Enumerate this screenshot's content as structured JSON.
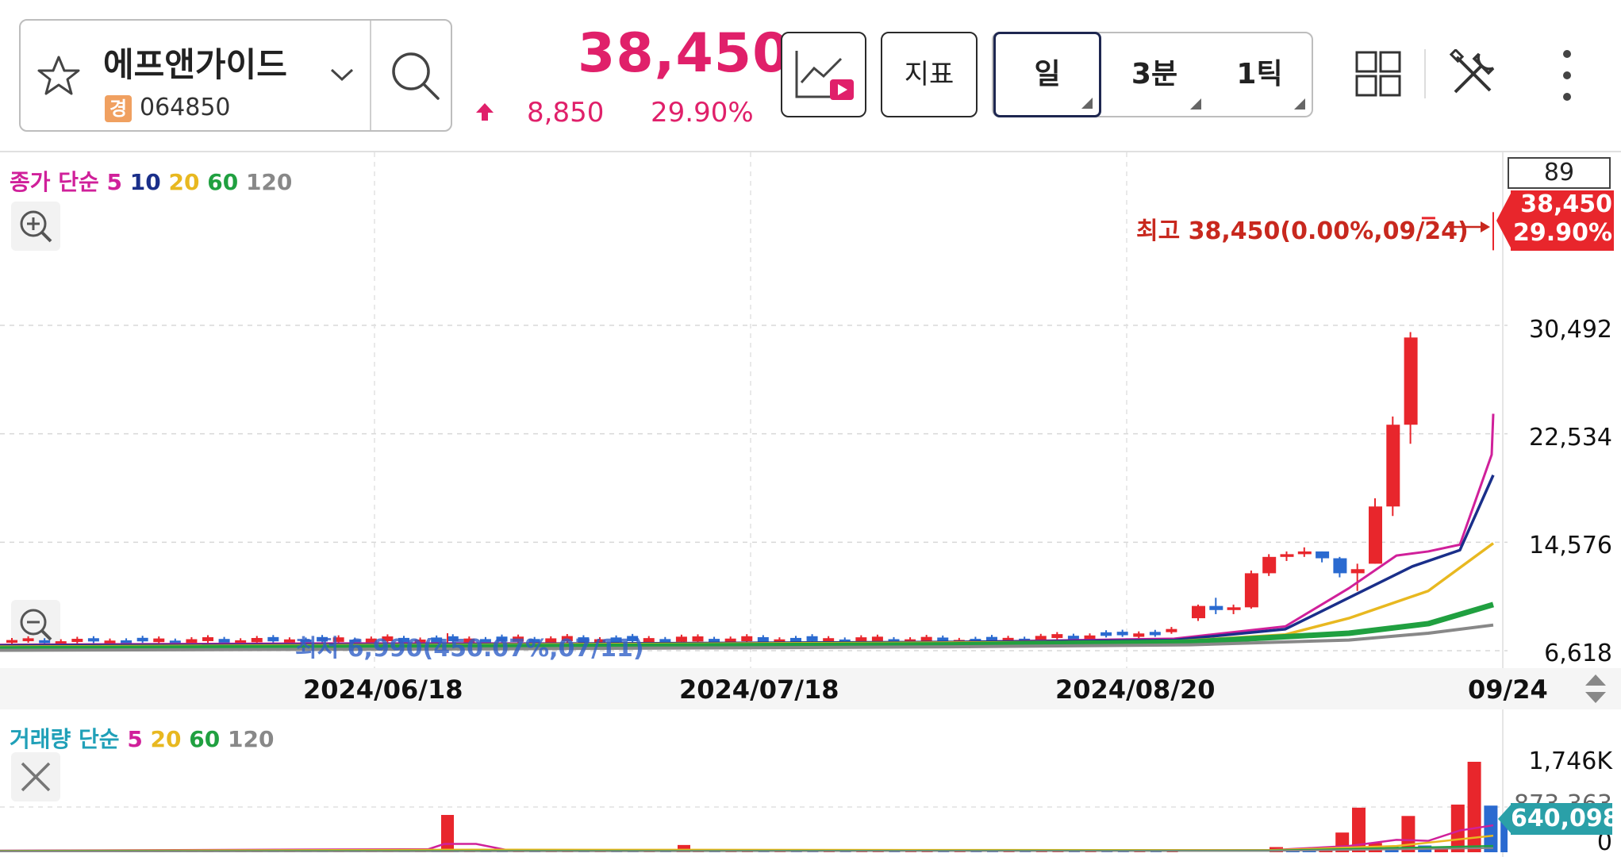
{
  "stock": {
    "name": "에프앤가이드",
    "market_badge": "경",
    "code": "064850",
    "price": "38,450",
    "change": "8,850",
    "change_rate": "29.90%",
    "up_color": "#e0206a"
  },
  "toolbar": {
    "indicator_label": "지표",
    "periods": [
      "일",
      "3분",
      "1틱"
    ],
    "active_period": "일"
  },
  "price_chart": {
    "legend_prefix": "종가 단순",
    "ma_legend": [
      {
        "label": "5",
        "color": "#d0209a"
      },
      {
        "label": "10",
        "color": "#1a2f8a"
      },
      {
        "label": "20",
        "color": "#e8b820"
      },
      {
        "label": "60",
        "color": "#20a040"
      },
      {
        "label": "120",
        "color": "#888888"
      }
    ],
    "count_box": "89",
    "current_tag": {
      "price": "38,450",
      "rate": "29.90%"
    },
    "high_annotation": "최고 38,450(0.00%,09/24)",
    "low_annotation": "최저 6,990(450.07%,07/11)",
    "y_ticks": [
      "30,492",
      "22,534",
      "14,576",
      "6,618"
    ],
    "x_dates": [
      "2024/06/18",
      "2024/07/18",
      "2024/08/20",
      "09/24"
    ]
  },
  "volume_chart": {
    "legend_prefix": "거래량 단순",
    "ma_legend": [
      {
        "label": "5",
        "color": "#d0209a"
      },
      {
        "label": "20",
        "color": "#e8b820"
      },
      {
        "label": "60",
        "color": "#20a040"
      },
      {
        "label": "120",
        "color": "#888888"
      }
    ],
    "y_ticks": [
      "1,746K",
      "873,363",
      "0"
    ],
    "current_tag": "640,098"
  },
  "chart_data": {
    "type": "candlestick",
    "ylim": [
      6618,
      38450
    ],
    "candles_recent": [
      {
        "o": 9000,
        "h": 10000,
        "l": 8800,
        "c": 9900
      },
      {
        "o": 9900,
        "h": 10500,
        "l": 9300,
        "c": 9600
      },
      {
        "o": 9600,
        "h": 10000,
        "l": 9300,
        "c": 9800
      },
      {
        "o": 9800,
        "h": 12500,
        "l": 9700,
        "c": 12300
      },
      {
        "o": 12300,
        "h": 13700,
        "l": 12100,
        "c": 13500
      },
      {
        "o": 13500,
        "h": 13900,
        "l": 13200,
        "c": 13700
      },
      {
        "o": 13700,
        "h": 14200,
        "l": 13500,
        "c": 13900
      },
      {
        "o": 13900,
        "h": 13900,
        "l": 13100,
        "c": 13400
      },
      {
        "o": 13400,
        "h": 13500,
        "l": 12000,
        "c": 12300
      },
      {
        "o": 12300,
        "h": 13000,
        "l": 11000,
        "c": 12600
      },
      {
        "o": 13000,
        "h": 17800,
        "l": 13000,
        "c": 17200
      },
      {
        "o": 17200,
        "h": 23800,
        "l": 16500,
        "c": 23200
      },
      {
        "o": 23200,
        "h": 30000,
        "l": 21800,
        "c": 29600
      },
      {
        "o": 38450,
        "h": 38450,
        "l": 38450,
        "c": 38450
      }
    ],
    "volume_recent": [
      {
        "v": 100000,
        "up": true
      },
      {
        "v": 50000,
        "up": false
      },
      {
        "v": 40000,
        "up": false
      },
      {
        "v": 60000,
        "up": true
      },
      {
        "v": 380000,
        "up": true
      },
      {
        "v": 860000,
        "up": true
      },
      {
        "v": 180000,
        "up": true
      },
      {
        "v": 120000,
        "up": false
      },
      {
        "v": 700000,
        "up": true
      },
      {
        "v": 130000,
        "up": false
      },
      {
        "v": 100000,
        "up": true
      },
      {
        "v": 920000,
        "up": true
      },
      {
        "v": 1746000,
        "up": true
      },
      {
        "v": 900000,
        "up": false
      },
      {
        "v": 640098,
        "up": false
      }
    ]
  }
}
